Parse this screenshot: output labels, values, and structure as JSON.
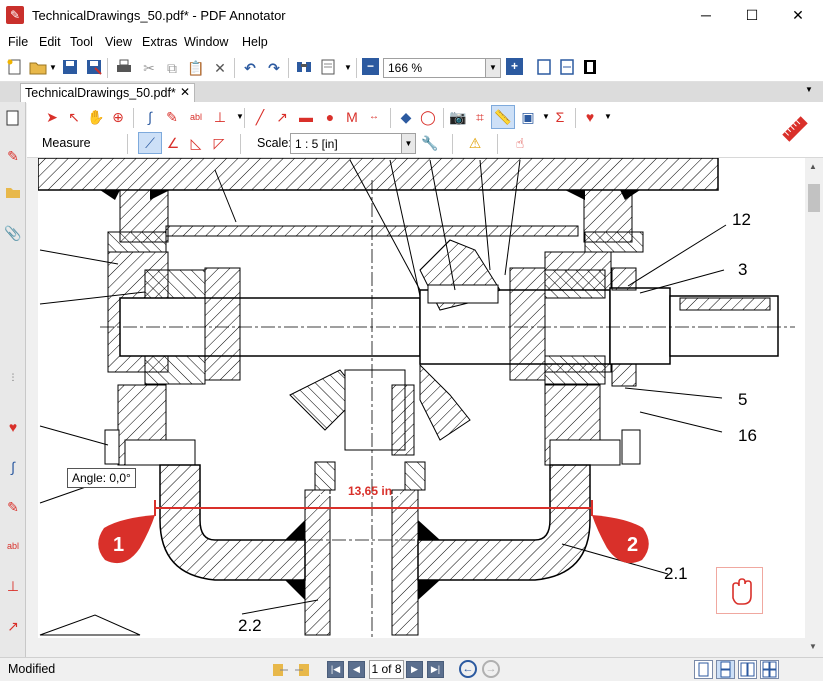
{
  "window": {
    "title": "TechnicalDrawings_50.pdf* - PDF Annotator",
    "app_icon": "pdf-annotator-icon",
    "controls": [
      "minimize",
      "maximize",
      "close"
    ]
  },
  "menu": [
    "File",
    "Edit",
    "Tool",
    "View",
    "Extras",
    "Window",
    "Help"
  ],
  "toolbar": {
    "zoom_value": "166 %"
  },
  "tab": {
    "label": "TechnicalDrawings_50.pdf*"
  },
  "annotation_bar": {
    "measure_label": "Measure",
    "scale_label": "Scale:",
    "scale_value": "1 : 5 [in]"
  },
  "drawing": {
    "labels": {
      "n12": "12",
      "n3": "3",
      "n5": "5",
      "n16": "16",
      "n21": "2.1",
      "n22": "2.2"
    },
    "measurement": "13,65 in",
    "angle_tooltip": "Angle: 0,0°",
    "callout_1": "1",
    "callout_2": "2",
    "accent_color": "#d9302a"
  },
  "status": {
    "text": "Modified",
    "page_indicator": "1 of 8"
  }
}
